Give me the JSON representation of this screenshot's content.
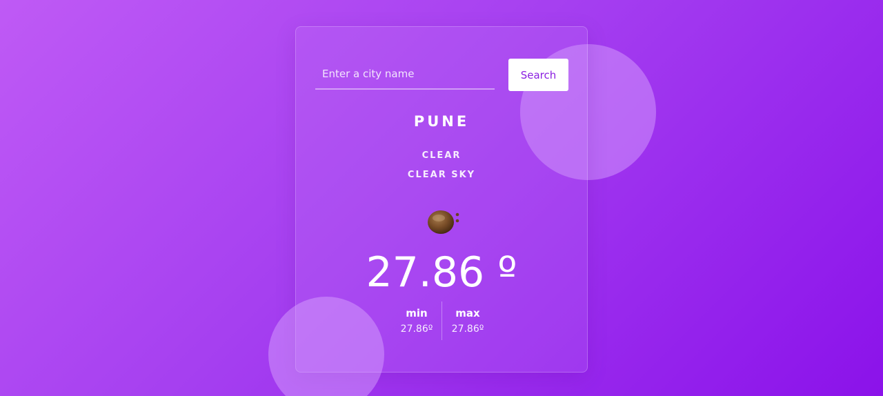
{
  "search": {
    "placeholder": "Enter a city name",
    "value": "",
    "button_label": "Search"
  },
  "weather": {
    "city": "PUNE",
    "main": "CLEAR",
    "description": "CLEAR SKY",
    "icon": "clear-sky-icon",
    "temperature": "27.86 º",
    "min_label": "min",
    "min_value": "27.86º",
    "max_label": "max",
    "max_value": "27.86º"
  },
  "colors": {
    "background_start": "#bf5af5",
    "background_end": "#8b12ea",
    "button_text": "#8a1ee0",
    "button_background": "#ffffff",
    "text": "#ffffff"
  }
}
